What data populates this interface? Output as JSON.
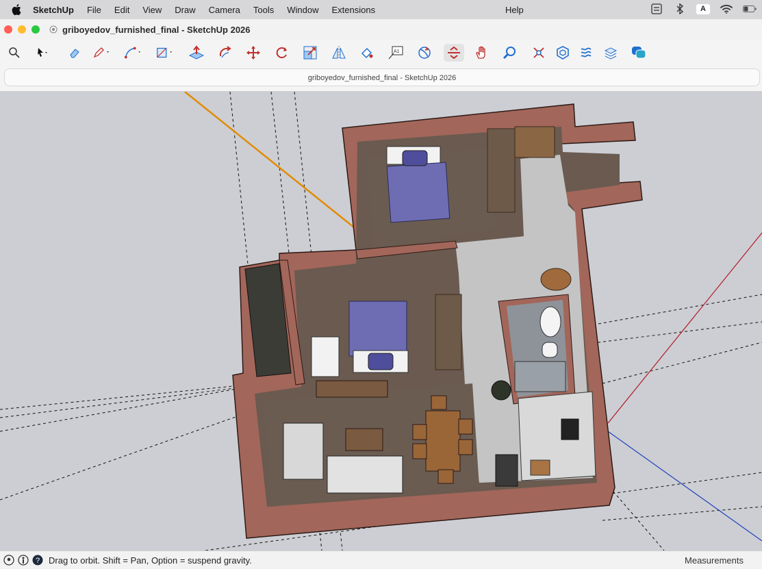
{
  "menubar": {
    "app_name": "SketchUp",
    "items": [
      "File",
      "Edit",
      "View",
      "Draw",
      "Camera",
      "Tools",
      "Window",
      "Extensions"
    ],
    "help": "Help",
    "input_source": "A"
  },
  "window": {
    "title": "griboyedov_furnished_final - SketchUp 2026",
    "address_title": "griboyedov_furnished_final - SketchUp 2026",
    "traffic_lights": {
      "close": "#ff5f57",
      "minimize": "#febc2e",
      "zoom": "#28c840"
    }
  },
  "toolbar": {
    "tools": [
      "search-icon",
      "select-icon",
      "eraser-icon",
      "pencil-icon",
      "arc-icon",
      "rectangle-icon",
      "push-pull-icon",
      "follow-me-icon",
      "move-icon",
      "rotate-icon",
      "scale-icon",
      "flip-icon",
      "paint-icon",
      "text-icon",
      "orbit-icon",
      "section-icon",
      "hand-icon",
      "zoom-icon",
      "zoom-extents-icon",
      "components-icon",
      "styles-icon",
      "layers-icon",
      "chat-icon"
    ]
  },
  "status": {
    "text": "Drag to orbit. Shift = Pan, Option = suspend gravity.",
    "measurements_label": "Measurements"
  },
  "colors": {
    "accent_blue": "#1f6fd0",
    "wall": "#b06a5c",
    "bed": "#6e6db4",
    "floor_wood": "#6a5a50",
    "floor_tile": "#c4c4c4"
  }
}
